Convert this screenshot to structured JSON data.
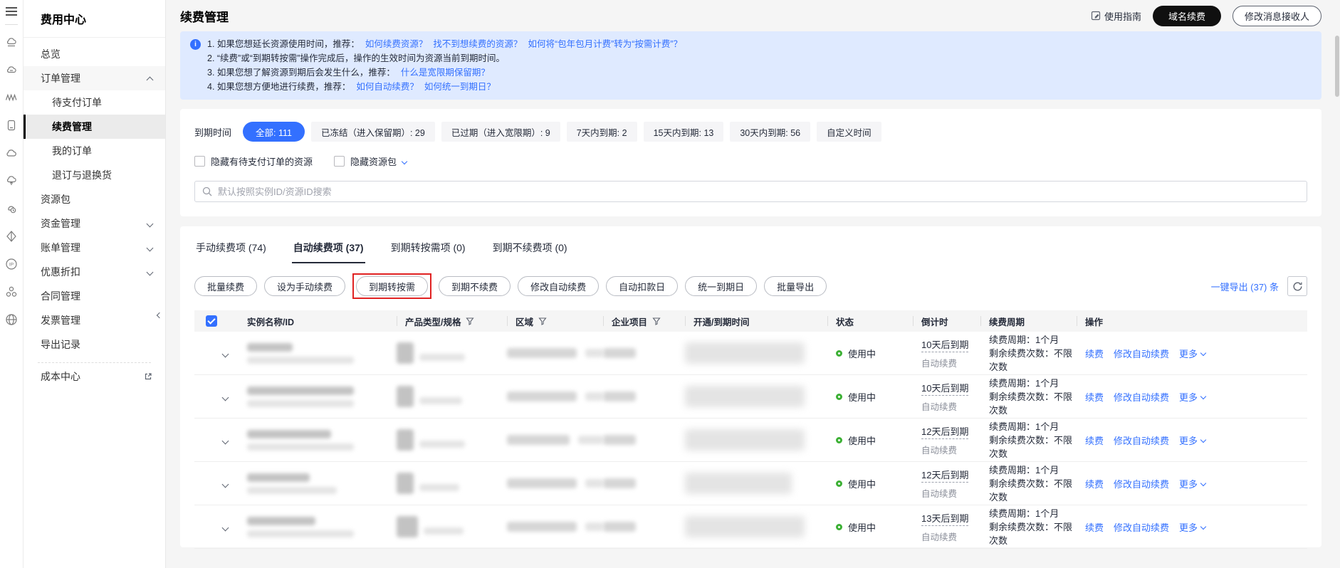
{
  "colors": {
    "accent": "#3370ff",
    "banner_bg": "#dfeaff",
    "status_green": "#3cb034",
    "highlight_red": "#e02222",
    "dark_button": "#101010"
  },
  "rail": {
    "icons": [
      "hamburger-menu",
      "cloud-server",
      "cloud-card",
      "waves",
      "device-cloud",
      "cloud",
      "cloud-upload",
      "cloud-clock",
      "prism",
      "ip-address",
      "cluster",
      "globe"
    ]
  },
  "sidebar": {
    "title": "费用中心",
    "items": [
      {
        "label": "总览"
      },
      {
        "label": "订单管理"
      },
      {
        "label": "待支付订单"
      },
      {
        "label": "续费管理"
      },
      {
        "label": "我的订单"
      },
      {
        "label": "退订与退换货"
      },
      {
        "label": "资源包"
      },
      {
        "label": "资金管理"
      },
      {
        "label": "账单管理"
      },
      {
        "label": "优惠折扣"
      },
      {
        "label": "合同管理"
      },
      {
        "label": "发票管理"
      },
      {
        "label": "导出记录"
      },
      {
        "label": "成本中心"
      }
    ]
  },
  "header": {
    "title": "续费管理",
    "guide": "使用指南",
    "domain_renew": "域名续费",
    "modify_receiver": "修改消息接收人"
  },
  "banner": {
    "l1_text": "1. 如果您想延长资源使用时间，推荐：",
    "l1_link1": "如何续费资源？",
    "l1_link2": "找不到想续费的资源？",
    "l1_link3": "如何将“包年包月计费”转为“按需计费”？",
    "l2_text": "2. “续费”或“到期转按需”操作完成后，操作的生效时间为资源当前到期时间。",
    "l3_text": "3. 如果您想了解资源到期后会发生什么，推荐：",
    "l3_link1": "什么是宽限期保留期？",
    "l4_text": "4. 如果您想方便地进行续费，推荐：",
    "l4_link1": "如何自动续费？",
    "l4_link2": "如何统一到期日？"
  },
  "filters": {
    "label": "到期时间",
    "options": [
      {
        "label": "全部: 111"
      },
      {
        "label": "已冻结（进入保留期）: 29"
      },
      {
        "label": "已过期（进入宽限期）: 9"
      },
      {
        "label": "7天内到期: 2"
      },
      {
        "label": "15天内到期: 13"
      },
      {
        "label": "30天内到期: 56"
      },
      {
        "label": "自定义时间"
      }
    ]
  },
  "hide": {
    "options": [
      {
        "label": "隐藏有待支付订单的资源"
      },
      {
        "label": "隐藏资源包"
      }
    ]
  },
  "search": {
    "placeholder": "默认按照实例ID/资源ID搜索"
  },
  "tabs": [
    {
      "label": "手动续费项 (74)"
    },
    {
      "label": "自动续费项 (37)"
    },
    {
      "label": "到期转按需项 (0)"
    },
    {
      "label": "到期不续费项 (0)"
    }
  ],
  "toolbar": {
    "buttons": [
      {
        "label": "批量续费"
      },
      {
        "label": "设为手动续费"
      },
      {
        "label": "到期转按需"
      },
      {
        "label": "到期不续费"
      },
      {
        "label": "修改自动续费"
      },
      {
        "label": "自动扣款日"
      },
      {
        "label": "统一到期日"
      },
      {
        "label": "批量导出"
      }
    ],
    "export_label": "一键导出 (37) 条"
  },
  "table": {
    "columns": [
      {
        "label": "实例名称/ID"
      },
      {
        "label": "产品类型/规格"
      },
      {
        "label": "区域"
      },
      {
        "label": "企业项目"
      },
      {
        "label": "开通/到期时间"
      },
      {
        "label": "状态"
      },
      {
        "label": "倒计时"
      },
      {
        "label": "续费周期"
      },
      {
        "label": "操作"
      }
    ],
    "rows": [
      {
        "status": "使用中",
        "countdown": "10天后到期",
        "mode": "自动续费",
        "period": "续费周期：1个月",
        "remaining": "剩余续费次数：不限次数",
        "action_renew": "续费",
        "action_modify": "修改自动续费",
        "action_more": "更多"
      },
      {
        "status": "使用中",
        "countdown": "10天后到期",
        "mode": "自动续费",
        "period": "续费周期：1个月",
        "remaining": "剩余续费次数：不限次数",
        "action_renew": "续费",
        "action_modify": "修改自动续费",
        "action_more": "更多"
      },
      {
        "status": "使用中",
        "countdown": "12天后到期",
        "mode": "自动续费",
        "period": "续费周期：1个月",
        "remaining": "剩余续费次数：不限次数",
        "action_renew": "续费",
        "action_modify": "修改自动续费",
        "action_more": "更多"
      },
      {
        "status": "使用中",
        "countdown": "12天后到期",
        "mode": "自动续费",
        "period": "续费周期：1个月",
        "remaining": "剩余续费次数：不限次数",
        "action_renew": "续费",
        "action_modify": "修改自动续费",
        "action_more": "更多"
      },
      {
        "status": "使用中",
        "countdown": "13天后到期",
        "mode": "自动续费",
        "period": "续费周期：1个月",
        "remaining": "剩余续费次数：不限次数",
        "action_renew": "续费",
        "action_modify": "修改自动续费",
        "action_more": "更多"
      }
    ]
  }
}
